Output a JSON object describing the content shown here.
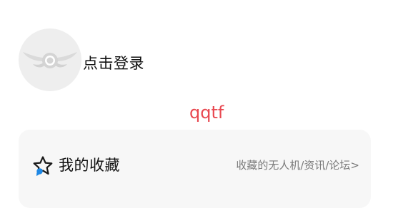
{
  "header": {
    "avatar_icon": "drone-logo-icon",
    "login_label": "点击登录"
  },
  "watermark": "qqtf",
  "favorites": {
    "icon": "star-icon",
    "title": "我的收藏",
    "subtitle": "收藏的无人机/资讯/论坛>"
  },
  "colors": {
    "accent_blue": "#1e88e5",
    "watermark_red": "#e8474f"
  }
}
